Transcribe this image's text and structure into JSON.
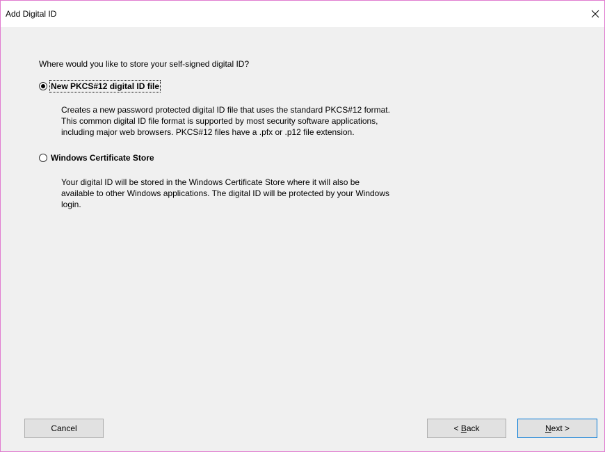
{
  "window": {
    "title": "Add Digital ID"
  },
  "main": {
    "question": "Where would you like to store your self-signed digital ID?",
    "options": [
      {
        "label": "New PKCS#12 digital ID file",
        "selected": true,
        "description": [
          "Creates a new password protected digital ID file that uses the standard PKCS#12 format.",
          "This common digital ID file format is supported by most security software applications,",
          "including major web browsers. PKCS#12 files have a .pfx or .p12 file extension."
        ]
      },
      {
        "label": "Windows Certificate Store",
        "selected": false,
        "description": [
          "Your digital ID will be stored in the Windows Certificate Store where it will also be",
          "available to other Windows applications. The digital ID will be protected by your Windows",
          "login."
        ]
      }
    ]
  },
  "buttons": {
    "cancel": "Cancel",
    "back_prefix": "< ",
    "back_mnemonic": "B",
    "back_rest": "ack",
    "next_mnemonic": "N",
    "next_rest": "ext >"
  },
  "icons": {
    "close": "close-icon",
    "radio": "radio-button"
  },
  "colors": {
    "window_border": "#e07bd0",
    "dialog_background": "#f0f0f0",
    "default_button_border": "#0078d7"
  }
}
